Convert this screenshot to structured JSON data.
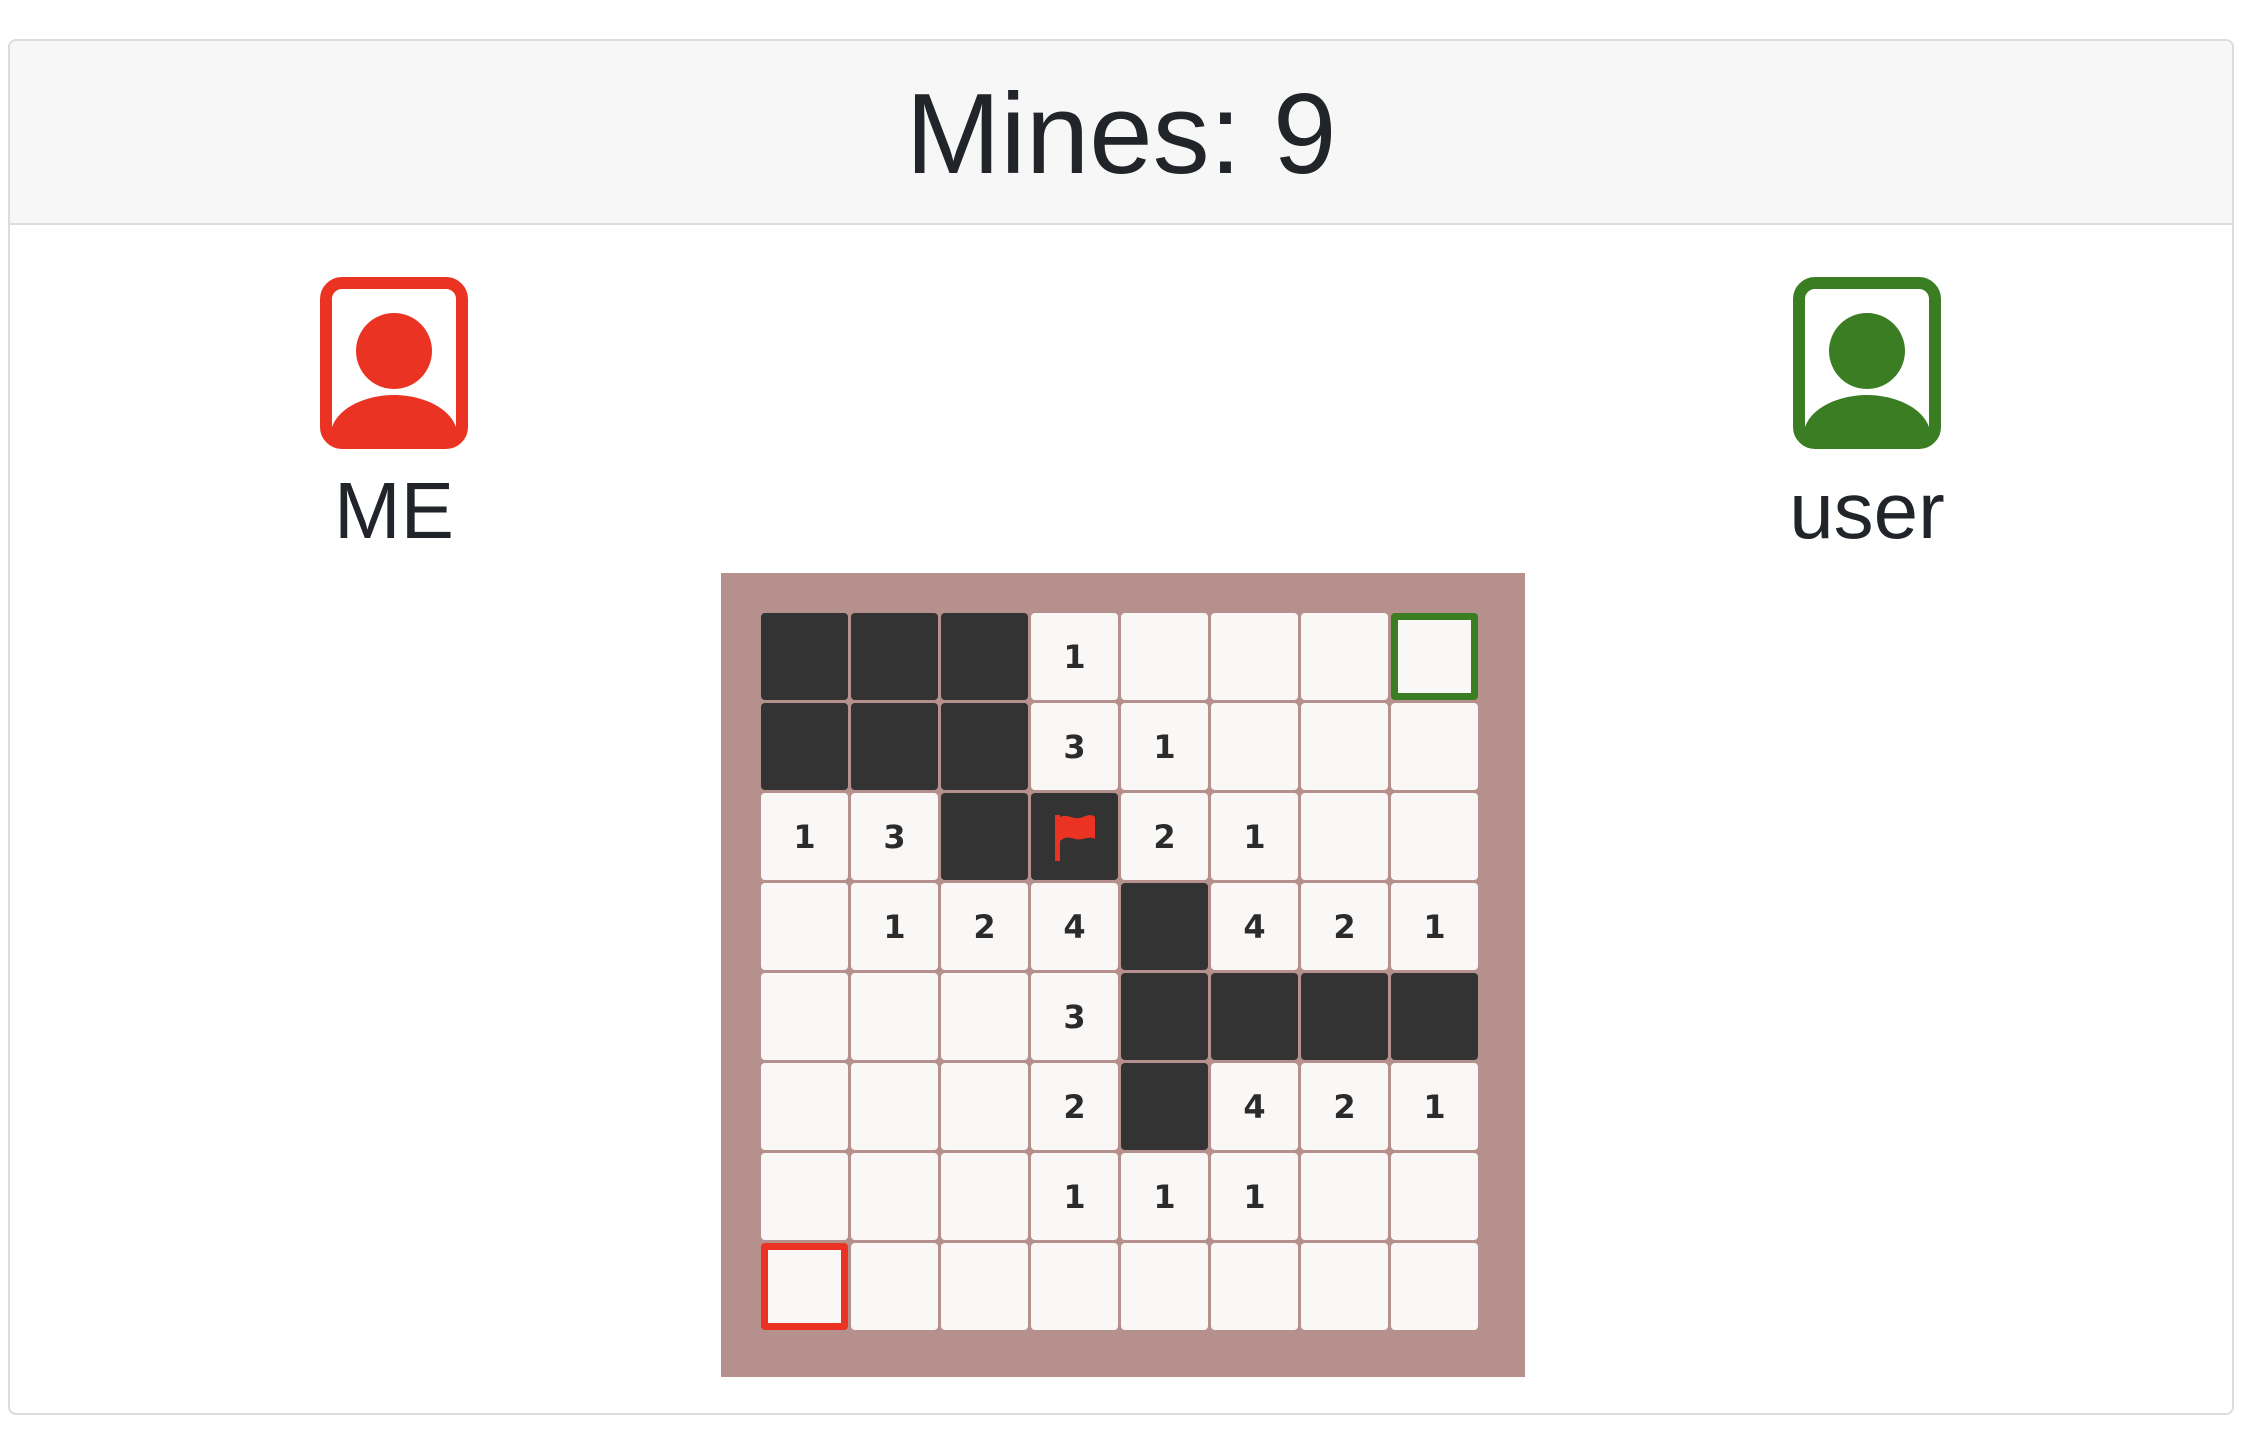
{
  "header": {
    "mines_label": "Mines: 9"
  },
  "players": {
    "me": {
      "name": "ME",
      "color": "#ea3323",
      "icon": "user-portrait-icon"
    },
    "opponent": {
      "name": "user",
      "color": "#3a7d22",
      "icon": "user-portrait-icon"
    }
  },
  "board": {
    "rows": 8,
    "cols": 8,
    "cells": [
      [
        "H",
        "H",
        "H",
        "1",
        "",
        "",
        "",
        ""
      ],
      [
        "H",
        "H",
        "H",
        "3",
        "1",
        "",
        "",
        ""
      ],
      [
        "1",
        "3",
        "H",
        "F",
        "2",
        "1",
        "",
        ""
      ],
      [
        "",
        "1",
        "2",
        "4",
        "H",
        "4",
        "2",
        "1"
      ],
      [
        "",
        "",
        "",
        "3",
        "H",
        "H",
        "H",
        "H"
      ],
      [
        "",
        "",
        "",
        "2",
        "H",
        "4",
        "2",
        "1"
      ],
      [
        "",
        "",
        "",
        "1",
        "1",
        "1",
        "",
        ""
      ],
      [
        "",
        "",
        "",
        "",
        "",
        "",
        "",
        ""
      ]
    ],
    "legend": {
      "H": "unrevealed",
      "F": "flag",
      "": "revealed-empty"
    },
    "flag_icon": "flag-icon",
    "flag_color": "#ea3323",
    "me_cursor": {
      "row": 7,
      "col": 0,
      "color": "#ea3323"
    },
    "opponent_cursor": {
      "row": 0,
      "col": 7,
      "color": "#3a7d22"
    }
  }
}
